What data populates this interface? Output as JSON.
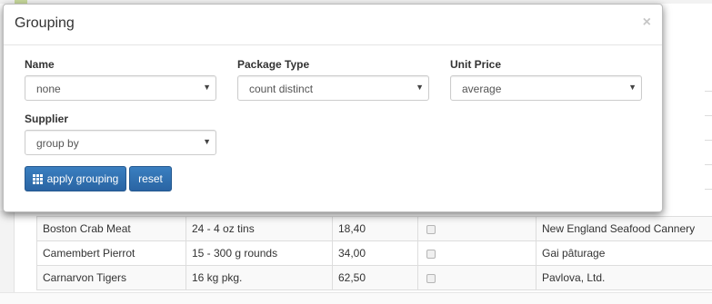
{
  "modal": {
    "title": "Grouping",
    "close_glyph": "×",
    "fields": [
      {
        "label": "Name",
        "value": "none"
      },
      {
        "label": "Package Type",
        "value": "count distinct"
      },
      {
        "label": "Unit Price",
        "value": "average"
      },
      {
        "label": "Supplier",
        "value": "group by"
      }
    ],
    "apply_label": "apply grouping",
    "reset_label": "reset",
    "apply_icon": "grid-icon",
    "caret_icon": "caret-down-icon"
  },
  "background_table": {
    "rows": [
      {
        "name": "Boston Crab Meat",
        "package": "24 - 4 oz tins",
        "price": "18,40",
        "discontinued": false,
        "supplier": "New England Seafood Cannery"
      },
      {
        "name": "Camembert Pierrot",
        "package": "15 - 300 g rounds",
        "price": "34,00",
        "discontinued": false,
        "supplier": "Gai pâturage"
      },
      {
        "name": "Carnarvon Tigers",
        "package": "16 kg pkg.",
        "price": "62,50",
        "discontinued": false,
        "supplier": "Pavlova, Ltd."
      }
    ]
  },
  "colors": {
    "button_primary": "#2a64a3",
    "modal_border": "#bdbdbd"
  }
}
